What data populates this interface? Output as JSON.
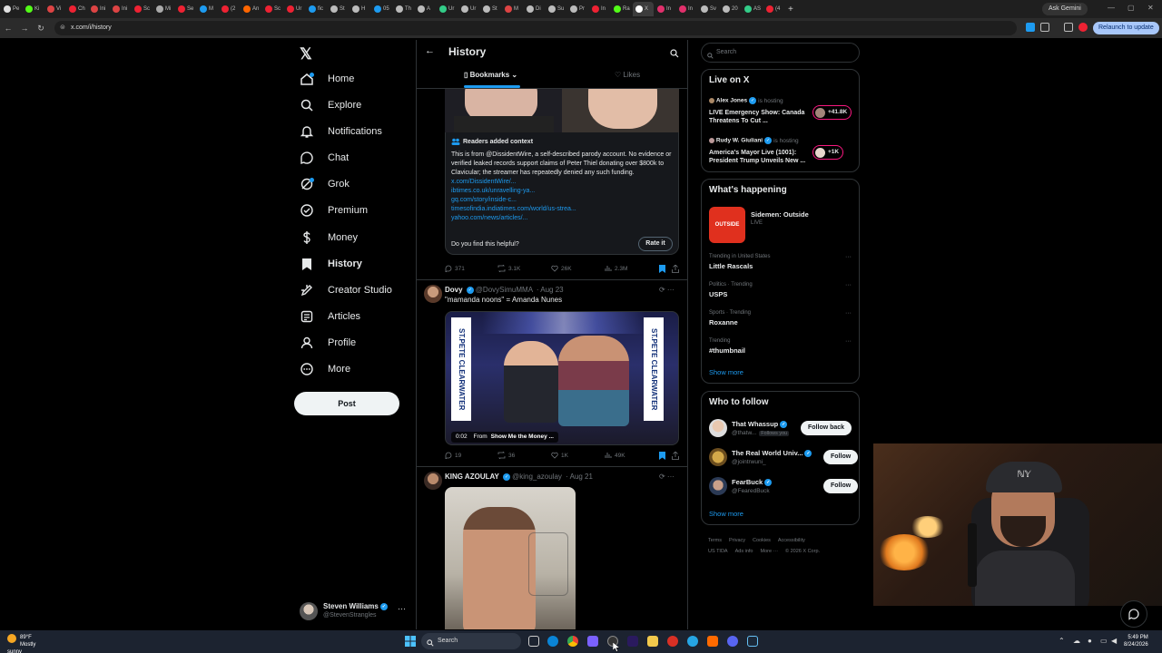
{
  "browser": {
    "tabs": [
      {
        "label": "Pe",
        "color": "#e0e0e0"
      },
      {
        "label": "Ki",
        "color": "#53fc18"
      },
      {
        "label": "Vi",
        "color": "#d44"
      },
      {
        "label": "Ch",
        "color": "#e23"
      },
      {
        "label": "Ini",
        "color": "#d44"
      },
      {
        "label": "Ini",
        "color": "#d44"
      },
      {
        "label": "Sc",
        "color": "#e23"
      },
      {
        "label": "Mi",
        "color": "#aaa"
      },
      {
        "label": "Se",
        "color": "#e23"
      },
      {
        "label": "M",
        "color": "#1d9bf0"
      },
      {
        "label": "(2",
        "color": "#e23"
      },
      {
        "label": "An",
        "color": "#f60"
      },
      {
        "label": "Sc",
        "color": "#e23"
      },
      {
        "label": "Ur",
        "color": "#e23"
      },
      {
        "label": "fic",
        "color": "#1d9bf0"
      },
      {
        "label": "St",
        "color": "#bbb"
      },
      {
        "label": "H",
        "color": "#bbb"
      },
      {
        "label": "05",
        "color": "#1d9bf0"
      },
      {
        "label": "Th",
        "color": "#bbb"
      },
      {
        "label": "A",
        "color": "#bbb"
      },
      {
        "label": "Ur",
        "color": "#3c8"
      },
      {
        "label": "Ur",
        "color": "#bbb"
      },
      {
        "label": "St",
        "color": "#bbb"
      },
      {
        "label": "M",
        "color": "#d44"
      },
      {
        "label": "Di",
        "color": "#bbb"
      },
      {
        "label": "Su",
        "color": "#bbb"
      },
      {
        "label": "Pr",
        "color": "#bbb"
      },
      {
        "label": "In",
        "color": "#e23"
      },
      {
        "label": "Ra",
        "color": "#53fc18"
      },
      {
        "label": "X",
        "color": "#fff",
        "active": true
      },
      {
        "label": "In",
        "color": "#e1306c"
      },
      {
        "label": "In",
        "color": "#e1306c"
      },
      {
        "label": "Sv",
        "color": "#bbb"
      },
      {
        "label": "20",
        "color": "#bbb"
      },
      {
        "label": "AS",
        "color": "#3c8"
      },
      {
        "label": "(4",
        "color": "#e23"
      }
    ],
    "new_tab": "+",
    "ask_gemini": "Ask Gemini",
    "url": "x.com/i/history",
    "relaunch": "Relaunch to update"
  },
  "sidebar": {
    "logo": "𝕏",
    "items": [
      {
        "label": "Home",
        "icon": "home-icon",
        "dot": true
      },
      {
        "label": "Explore",
        "icon": "search-icon"
      },
      {
        "label": "Notifications",
        "icon": "bell-icon"
      },
      {
        "label": "Chat",
        "icon": "chat-icon"
      },
      {
        "label": "Grok",
        "icon": "grok-icon",
        "dot": true
      },
      {
        "label": "Premium",
        "icon": "premium-icon"
      },
      {
        "label": "Money",
        "icon": "money-icon"
      },
      {
        "label": "History",
        "icon": "history-icon",
        "active": true
      },
      {
        "label": "Creator Studio",
        "icon": "creator-studio-icon"
      },
      {
        "label": "Articles",
        "icon": "articles-icon"
      },
      {
        "label": "Profile",
        "icon": "profile-icon"
      },
      {
        "label": "More",
        "icon": "more-icon"
      }
    ],
    "post_button": "Post",
    "user": {
      "name": "Steven Williams",
      "handle": "@StevenStrangles",
      "more": "···"
    }
  },
  "main": {
    "title": "History",
    "tabs": {
      "bookmarks": "Bookmarks",
      "likes": "Likes"
    },
    "note": {
      "header": "Readers added context",
      "body": "This is from @DissidentWire, a self-described parody account. No evidence or verified leaked records support claims of Peter Thiel donating over $800k to Clavicular; the streamer has repeatedly denied any such funding.",
      "links": [
        "x.com/DissidentWire/...",
        "ibtimes.co.uk/unravelling-ya...",
        "gq.com/story/inside-c...",
        "timesofindia.indiatimes.com/world/us-strea...",
        "yahoo.com/news/articles/..."
      ],
      "helpful_question": "Do you find this helpful?",
      "rate_button": "Rate it"
    },
    "tweet1_actions": {
      "replies": "371",
      "reposts": "3.1K",
      "likes": "26K",
      "views": "2.3M"
    },
    "tweet2": {
      "name": "Dovy",
      "handle": "@DovySimuMMA",
      "date": "· Aug 23",
      "text": "\"mamanda noons\" = Amanda Nunes",
      "video_time": "0:02",
      "video_from": "From",
      "video_source": "Show Me the Money ...",
      "banner_text": "ST.PETE CLEARWATER",
      "actions": {
        "replies": "19",
        "reposts": "36",
        "likes": "1K",
        "views": "49K"
      }
    },
    "tweet3": {
      "name": "KING AZOULAY",
      "handle": "@king_azoulay",
      "date": "· Aug 21"
    }
  },
  "right": {
    "search_placeholder": "Search",
    "live": {
      "title": "Live on X",
      "items": [
        {
          "host": "Alex Jones",
          "status": "is hosting",
          "title": "LIVE Emergency Show: Canada Threatens To Cut ...",
          "count": "+41.8K"
        },
        {
          "host": "Rudy W. Giuliani",
          "status": "is hosting",
          "title": "America's Mayor Live (1001): President Trump Unveils New ...",
          "count": "+1K"
        }
      ]
    },
    "happening": {
      "title": "What's happening",
      "featured": {
        "title": "Sidemen: Outside",
        "sub": "LIVE",
        "thumb": "OUTSIDE"
      },
      "trends": [
        {
          "context": "Trending in United States",
          "title": "Little Rascals"
        },
        {
          "context": "Politics · Trending",
          "title": "USPS"
        },
        {
          "context": "Sports · Trending",
          "title": "Roxanne"
        },
        {
          "context": "Trending",
          "title": "#thumbnail"
        }
      ],
      "show_more": "Show more",
      "more_dots": "···"
    },
    "who_to_follow": {
      "title": "Who to follow",
      "items": [
        {
          "name": "That Whassup",
          "handle": "@thatw...",
          "follows_you": "Follows you",
          "button": "Follow back"
        },
        {
          "name": "The Real World Univ...",
          "handle": "@jointrwuni_",
          "button": "Follow"
        },
        {
          "name": "FearBuck",
          "handle": "@FearedBuck",
          "button": "Follow"
        }
      ],
      "show_more": "Show more"
    },
    "footer": [
      "Terms",
      "Privacy",
      "Cookies",
      "Accessibility",
      "US TIDA",
      "Ads info",
      "More ···",
      "© 2026 X Corp."
    ]
  },
  "taskbar": {
    "weather_temp": "89°F",
    "weather_desc": "Mostly sunny",
    "search": "Search",
    "time": "5:49 PM",
    "date": "8/24/2026"
  },
  "colors": {
    "accent": "#1d9bf0",
    "live": "#f91880",
    "background": "#000000"
  }
}
